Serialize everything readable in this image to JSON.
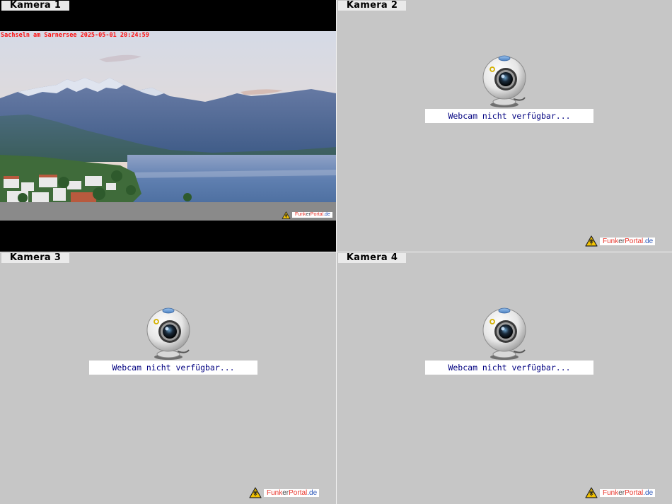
{
  "cameras": [
    {
      "label": "Kamera 1",
      "overlay": "Sachseln am Sarnersee 2025-05-01 20:24:59"
    },
    {
      "label": "Kamera 2",
      "status": "Webcam nicht verfügbar..."
    },
    {
      "label": "Kamera 3",
      "status": "Webcam nicht verfügbar..."
    },
    {
      "label": "Kamera 4",
      "status": "Webcam nicht verfügbar..."
    }
  ],
  "watermark": {
    "part1": "Funk",
    "part2": "er",
    "part3": "Portal",
    "part4": ".de"
  },
  "colors": {
    "tile_bg": "#c6c6c6",
    "overlay_text": "#ff1010",
    "status_text": "#000080",
    "label_bg": "#eaeaea"
  },
  "icons": {
    "webcam": "webcam-icon",
    "logo": "funkerportal-logo-icon"
  }
}
